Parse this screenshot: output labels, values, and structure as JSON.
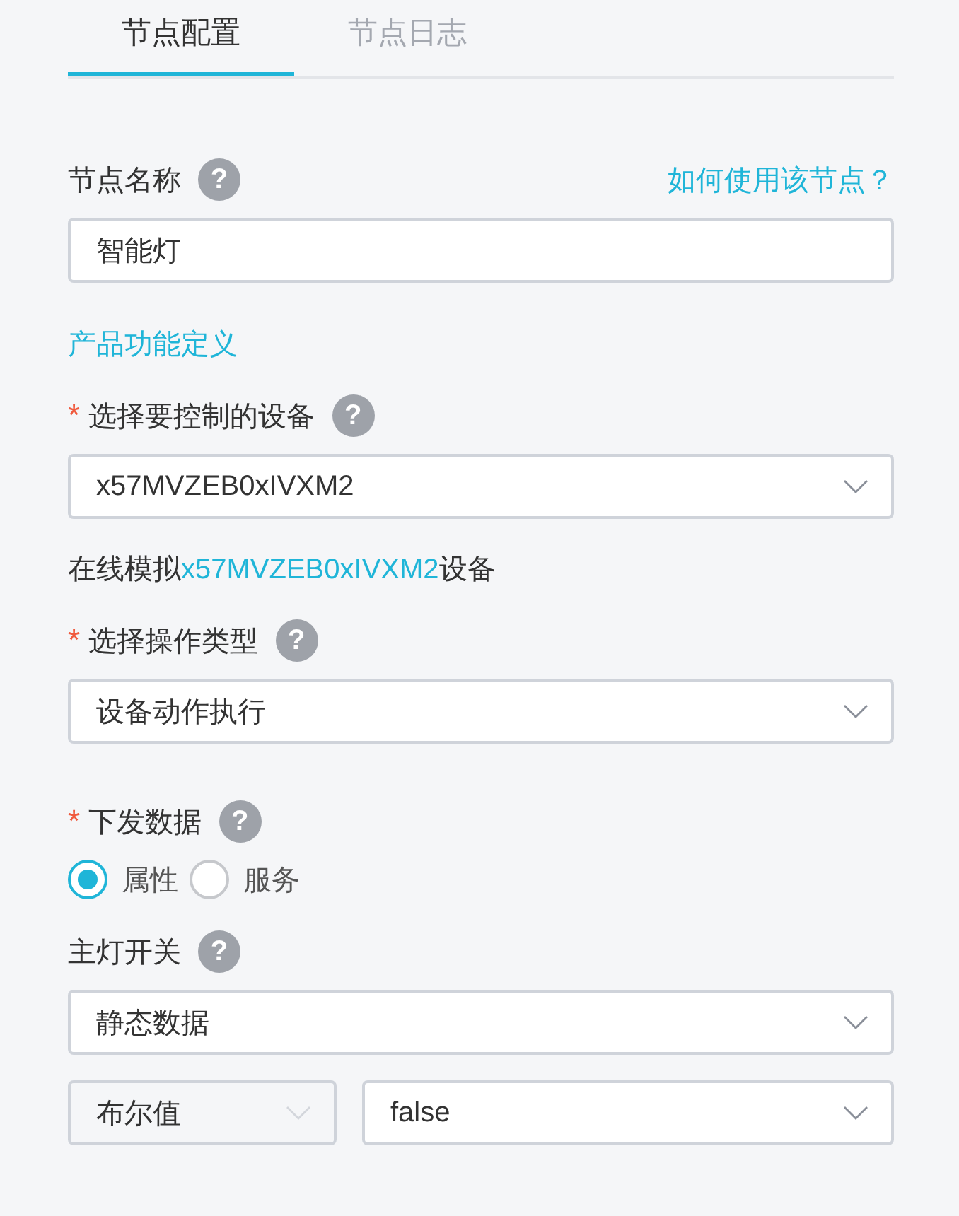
{
  "tabs": [
    {
      "label": "节点配置",
      "selected": true
    },
    {
      "label": "节点日志",
      "selected": false
    }
  ],
  "node_name": {
    "label": "节点名称",
    "help": "?",
    "help_link": "如何使用该节点？",
    "value": "智能灯"
  },
  "product_link": "产品功能定义",
  "device": {
    "required_mark": "*",
    "label": "选择要控制的设备",
    "help": "?",
    "value": "x57MVZEB0xIVXM2"
  },
  "simulate": {
    "prefix": "在线模拟",
    "link": "x57MVZEB0xIVXM2",
    "suffix": "设备"
  },
  "operation": {
    "required_mark": "*",
    "label": "选择操作类型",
    "help": "?",
    "value": "设备动作执行"
  },
  "send_data": {
    "required_mark": "*",
    "label": "下发数据",
    "help": "?",
    "options": [
      {
        "label": "属性",
        "selected": true
      },
      {
        "label": "服务",
        "selected": false
      }
    ]
  },
  "main_switch": {
    "label": "主灯开关",
    "help": "?",
    "value": "静态数据"
  },
  "value_row": [
    {
      "value": "布尔值",
      "disabled": true
    },
    {
      "value": "false",
      "disabled": false
    }
  ]
}
